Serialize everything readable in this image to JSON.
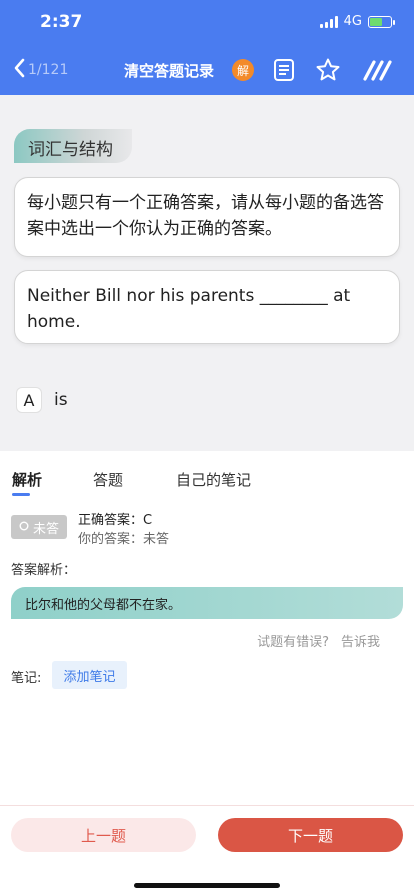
{
  "status_bar": {
    "time": "2:37",
    "network": "4G",
    "battery_level": 0.6
  },
  "navbar": {
    "back_icon": "chevron-left-icon",
    "counter": "1/121",
    "title": "清空答题记录",
    "badge": "解",
    "icons": [
      "document-icon",
      "star-icon",
      "slashes-menu-icon"
    ],
    "colors": {
      "bar": "#4a7cf0",
      "badge": "#f38a2a"
    }
  },
  "question": {
    "section": "词汇与结构",
    "instruction": "每小题只有一个正确答案，请从每小题的备选答案中选出一个你认为正确的答案。",
    "stem": "Neither Bill nor his parents ________ at home.",
    "options": [
      {
        "letter": "A",
        "text": "is"
      }
    ]
  },
  "analysis": {
    "tabs": [
      "解析",
      "答题",
      "自己的笔记"
    ],
    "active_tab": 0,
    "status": "未答",
    "status_icon": "circle-icon",
    "correct_answer": "正确答案：C",
    "your_answer": "你的答案：未答",
    "analysis_label": "答案解析：",
    "analysis_text": "比尔和他的父母都不在家。",
    "report_q": "试题有错误?",
    "report_link": "告诉我",
    "note_label": "笔记:",
    "add_note": "添加笔记"
  },
  "footer": {
    "prev": "上一题",
    "next": "下一题",
    "colors": {
      "next": "#da5645",
      "prev_bg": "#fbe8e8"
    }
  }
}
